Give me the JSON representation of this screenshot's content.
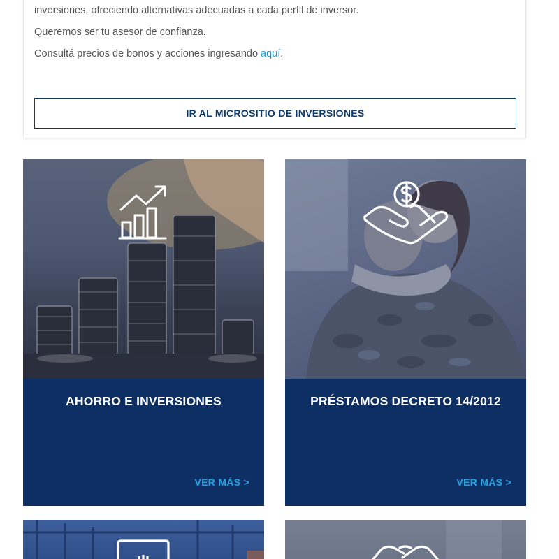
{
  "info": {
    "line1": "inversiones, ofreciendo alternativas adecuadas a cada perfil de inversor.",
    "line2": "Queremos ser tu asesor de confianza.",
    "line3_prefix": "Consultá precios de bonos y acciones ingresando ",
    "line3_link": "aquí",
    "line3_suffix": ".",
    "cta_label": "IR AL MICROSITIO DE INVERSIONES"
  },
  "cards": [
    {
      "title": "AHORRO E INVERSIONES",
      "more": "VER MÁS >",
      "icon": "growth-chart-icon"
    },
    {
      "title": "PRÉSTAMOS DECRETO 14/2012",
      "more": "VER MÁS >",
      "icon": "money-hand-icon"
    },
    {
      "title": "",
      "more": "",
      "icon": "invoice-icon"
    },
    {
      "title": "",
      "more": "",
      "icon": "handshake-icon"
    }
  ],
  "colors": {
    "panel": "#0d2f63",
    "accent_link": "#27a5e3",
    "cta_border": "#0d3a6b"
  }
}
